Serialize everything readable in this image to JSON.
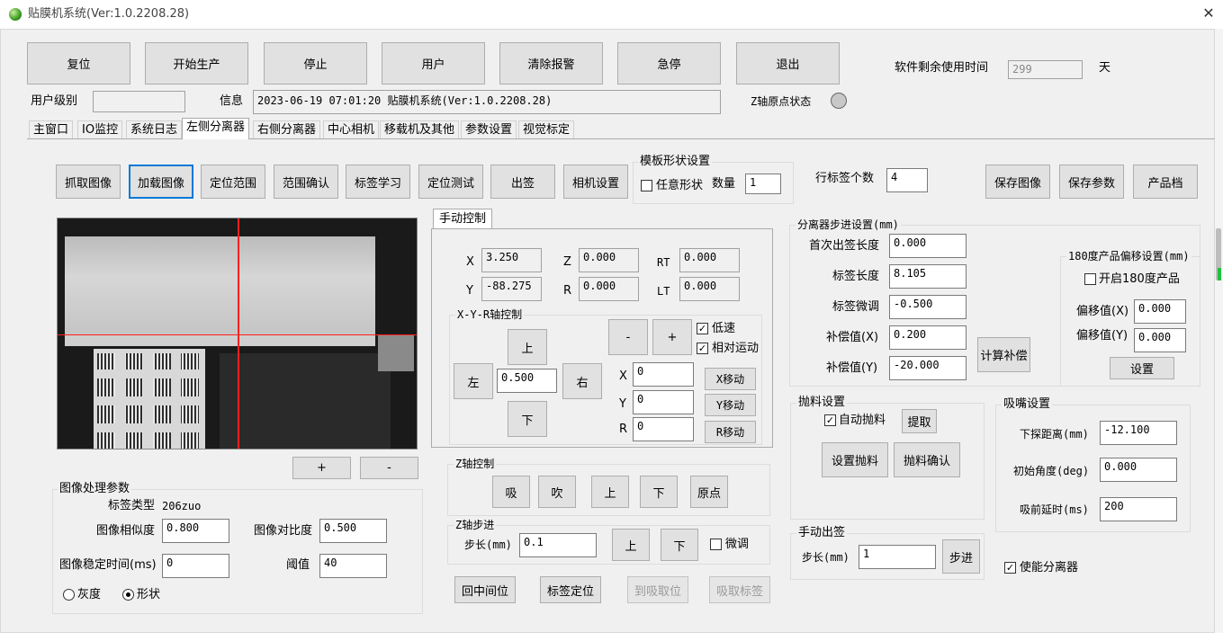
{
  "window": {
    "title": "贴膜机系统(Ver:1.0.2208.28)"
  },
  "toolbar": {
    "reset": "复位",
    "start": "开始生产",
    "stop": "停止",
    "user": "用户",
    "clear_alarm": "清除报警",
    "estop": "急停",
    "exit": "退出",
    "remaining_label": "软件剩余使用时间",
    "remaining_value": "299",
    "remaining_unit": "天"
  },
  "status": {
    "user_level_label": "用户级别",
    "user_level_value": "",
    "info_label": "信息",
    "info_value": "2023-06-19 07:01:20 贴膜机系统(Ver:1.0.2208.28)",
    "z_origin_label": "Z轴原点状态"
  },
  "tabs": [
    "主窗口",
    "IO监控",
    "系统日志",
    "左侧分离器",
    "右侧分离器",
    "中心相机",
    "移载机及其他",
    "参数设置",
    "视觉标定"
  ],
  "actions": {
    "grab": "抓取图像",
    "load": "加载图像",
    "locate_range": "定位范围",
    "confirm_range": "范围确认",
    "learn": "标签学习",
    "locate_test": "定位测试",
    "out": "出签",
    "cam_settings": "相机设置",
    "save_image": "保存图像",
    "save_params": "保存参数",
    "product": "产品档"
  },
  "template": {
    "title": "模板形状设置",
    "any_shape": "任意形状",
    "count_label": "数量",
    "count_value": "1"
  },
  "row_labels": {
    "label": "行标签个数",
    "value": "4"
  },
  "image_buttons": {
    "plus": "+",
    "minus": "-"
  },
  "manual": {
    "tab": "手动控制",
    "x_label": "X",
    "x": "3.250",
    "y_label": "Y",
    "y": "-88.275",
    "z_label": "Z",
    "z": "0.000",
    "r_label": "R",
    "r": "0.000",
    "rt_label": "RT",
    "rt": "0.000",
    "lt_label": "LT",
    "lt": "0.000",
    "xyr_title": "X-Y-R轴控制",
    "up": "上",
    "down": "下",
    "left": "左",
    "right": "右",
    "step": "0.500",
    "minus": "-",
    "plus": "+",
    "low_speed": "低速",
    "relative": "相对运动",
    "move_x_label": "X",
    "move_x": "0",
    "move_y_label": "Y",
    "move_y": "0",
    "move_r_label": "R",
    "move_r": "0",
    "x_move": "X移动",
    "y_move": "Y移动",
    "r_move": "R移动"
  },
  "z_control": {
    "title": "Z轴控制",
    "suck": "吸",
    "blow": "吹",
    "up": "上",
    "down": "下",
    "origin": "原点"
  },
  "z_step": {
    "title": "Z轴步进",
    "step_label": "步长(mm)",
    "step_value": "0.1",
    "up": "上",
    "down": "下",
    "fine": "微调"
  },
  "bottom_buttons": {
    "back_mid": "回中间位",
    "label_locate": "标签定位",
    "to_pick": "到吸取位",
    "pick_label": "吸取标签"
  },
  "image_params": {
    "title": "图像处理参数",
    "label_type_label": "标签类型",
    "label_type_value": "206zuo",
    "similarity_label": "图像相似度",
    "similarity": "0.800",
    "contrast_label": "图像对比度",
    "contrast": "0.500",
    "stable_label": "图像稳定时间(ms)",
    "stable": "0",
    "threshold_label": "阈值",
    "threshold": "40",
    "gray": "灰度",
    "shape": "形状"
  },
  "separator": {
    "title": "分离器步进设置(mm)",
    "first_label": "首次出签长度",
    "first": "0.000",
    "length_label": "标签长度",
    "length": "8.105",
    "fine_label": "标签微调",
    "fine": "-0.500",
    "comp_x_label": "补偿值(X)",
    "comp_x": "0.200",
    "comp_y_label": "补偿值(Y)",
    "comp_y": "-20.000",
    "calc": "计算补偿"
  },
  "offset180": {
    "title": "180度产品偏移设置(mm)",
    "enable": "开启180度产品",
    "ox_label": "偏移值(X)",
    "ox": "0.000",
    "oy_label": "偏移值(Y)",
    "oy": "0.000",
    "set": "设置"
  },
  "discard": {
    "title": "抛料设置",
    "auto": "自动抛料",
    "pick": "提取",
    "set": "设置抛料",
    "confirm": "抛料确认"
  },
  "nozzle": {
    "title": "吸嘴设置",
    "probe_label": "下探距离(mm)",
    "probe": "-12.100",
    "angle_label": "初始角度(deg)",
    "angle": "0.000",
    "delay_label": "吸前延时(ms)",
    "delay": "200"
  },
  "manual_out": {
    "title": "手动出签",
    "step_label": "步长(mm)",
    "step": "1",
    "go": "步进"
  },
  "enable_separator": "使能分离器",
  "colors": {
    "accent": "#0078d7",
    "panel": "#f0f0f0",
    "crosshair": "#ff2020"
  }
}
